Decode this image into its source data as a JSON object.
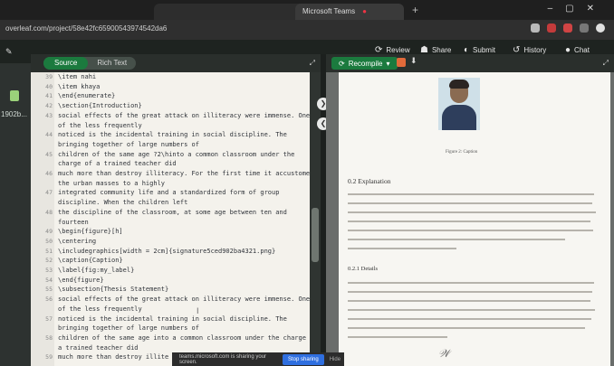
{
  "browser": {
    "tab1_title": "",
    "tab2_title": "Microsoft Teams",
    "url": "overleaf.com/project/58e42fc65900543974542da6"
  },
  "overleaf": {
    "project_title": "",
    "review": "Review",
    "share": "Share",
    "submit": "Submit",
    "history": "History",
    "chat": "Chat",
    "source": "Source",
    "rich_text": "Rich Text",
    "recompile": "Recompile",
    "left_rail_text": "1902b..."
  },
  "editor": {
    "lines": [
      {
        "n": "39",
        "text": "      \\item nahi"
      },
      {
        "n": "40",
        "text": "      \\item khaya"
      },
      {
        "n": "41",
        "text": "\\end{enumerate}"
      },
      {
        "n": "42",
        "text": "\\section{Introduction}"
      },
      {
        "n": "43",
        "text": "social effects of the great attack on illiteracy were immense. One"
      },
      {
        "n": "",
        "text": "of the less frequently"
      },
      {
        "n": "44",
        "text": "noticed is the incidental training in social discipline. The"
      },
      {
        "n": "",
        "text": "bringing together of large numbers of"
      },
      {
        "n": "45",
        "text": "children of the same age ?2\\hinto a common classroom under the"
      },
      {
        "n": "",
        "text": "charge of a trained teacher did"
      },
      {
        "n": "46",
        "text": "much more than destroy illiteracy. For the first time it accustomed"
      },
      {
        "n": "",
        "text": "the urban masses to a highly"
      },
      {
        "n": "47",
        "text": "integrated community life and a standardized form of group"
      },
      {
        "n": "",
        "text": "discipline. When the children left"
      },
      {
        "n": "48",
        "text": "the discipline of the classroom, at some age between ten and"
      },
      {
        "n": "",
        "text": "fourteen"
      },
      {
        "n": "49",
        "text": "\\begin{figure}[h]"
      },
      {
        "n": "50",
        "text": "    \\centering"
      },
      {
        "n": "51",
        "text": "    \\includegraphics[width = 2cm]{signature5ced902ba4321.png}"
      },
      {
        "n": "52",
        "text": "    \\caption{Caption}"
      },
      {
        "n": "53",
        "text": "    \\label{fig:my_label}"
      },
      {
        "n": "54",
        "text": "\\end{figure}"
      },
      {
        "n": "55",
        "text": "\\subsection{Thesis Statement}"
      },
      {
        "n": "56",
        "text": "social effects of the great attack on illiteracy were immense. One"
      },
      {
        "n": "",
        "text": "of the less frequently"
      },
      {
        "n": "57",
        "text": "noticed is the incidental training in social discipline. The"
      },
      {
        "n": "",
        "text": "bringing together of large numbers of"
      },
      {
        "n": "58",
        "text": "children of the same age into a common classroom under the charge of"
      },
      {
        "n": "",
        "text": "a trained teacher did"
      },
      {
        "n": "59",
        "text": "much more than destroy illite"
      }
    ]
  },
  "pdf": {
    "figure_caption": "Figure 2: Caption",
    "section_heading": "0.2   Explanation",
    "subsection_heading": "0.2.1   Details"
  },
  "screenshare": {
    "text": "teams.microsoft.com is sharing your screen.",
    "stop": "Stop sharing",
    "hide": "Hide"
  }
}
